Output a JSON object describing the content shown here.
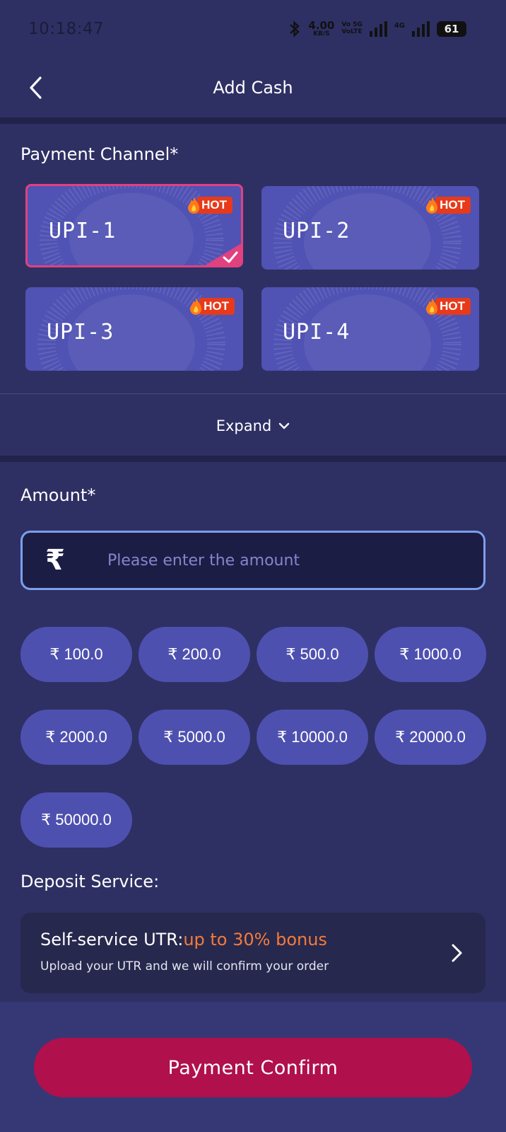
{
  "status_bar": {
    "time": "10:18:47",
    "speed_value": "4.00",
    "speed_unit": "KB/S",
    "volte_top": "Vo 5G",
    "volte_bottom": "VoLTE",
    "network_label": "4G",
    "battery": "61"
  },
  "header": {
    "title": "Add Cash",
    "back_icon": "chevron-left-icon"
  },
  "payment": {
    "label": "Payment Channel*",
    "channels": [
      {
        "label": "UPI-1",
        "badge": "HOT",
        "selected": true
      },
      {
        "label": "UPI-2",
        "badge": "HOT",
        "selected": false
      },
      {
        "label": "UPI-3",
        "badge": "HOT",
        "selected": false
      },
      {
        "label": "UPI-4",
        "badge": "HOT",
        "selected": false
      }
    ],
    "expand_label": "Expand"
  },
  "amount": {
    "label": "Amount*",
    "currency_symbol": "₹",
    "placeholder": "Please enter the amount",
    "presets": [
      "₹ 100.0",
      "₹ 200.0",
      "₹ 500.0",
      "₹ 1000.0",
      "₹ 2000.0",
      "₹ 5000.0",
      "₹ 10000.0",
      "₹ 20000.0",
      "₹ 50000.0"
    ]
  },
  "deposit_service": {
    "label": "Deposit Service:",
    "title": "Self-service UTR:",
    "bonus": "up to 30% bonus",
    "description": "Upload your UTR and we will confirm your order"
  },
  "footer": {
    "confirm_label": "Payment Confirm"
  },
  "colors": {
    "background": "#2e3064",
    "card": "#5052b4",
    "selected_border": "#e0417f",
    "hot_badge": "#e63a1b",
    "input_border": "#7c9fe9",
    "bonus_text": "#f47b3a",
    "confirm_button": "#b0104c"
  }
}
